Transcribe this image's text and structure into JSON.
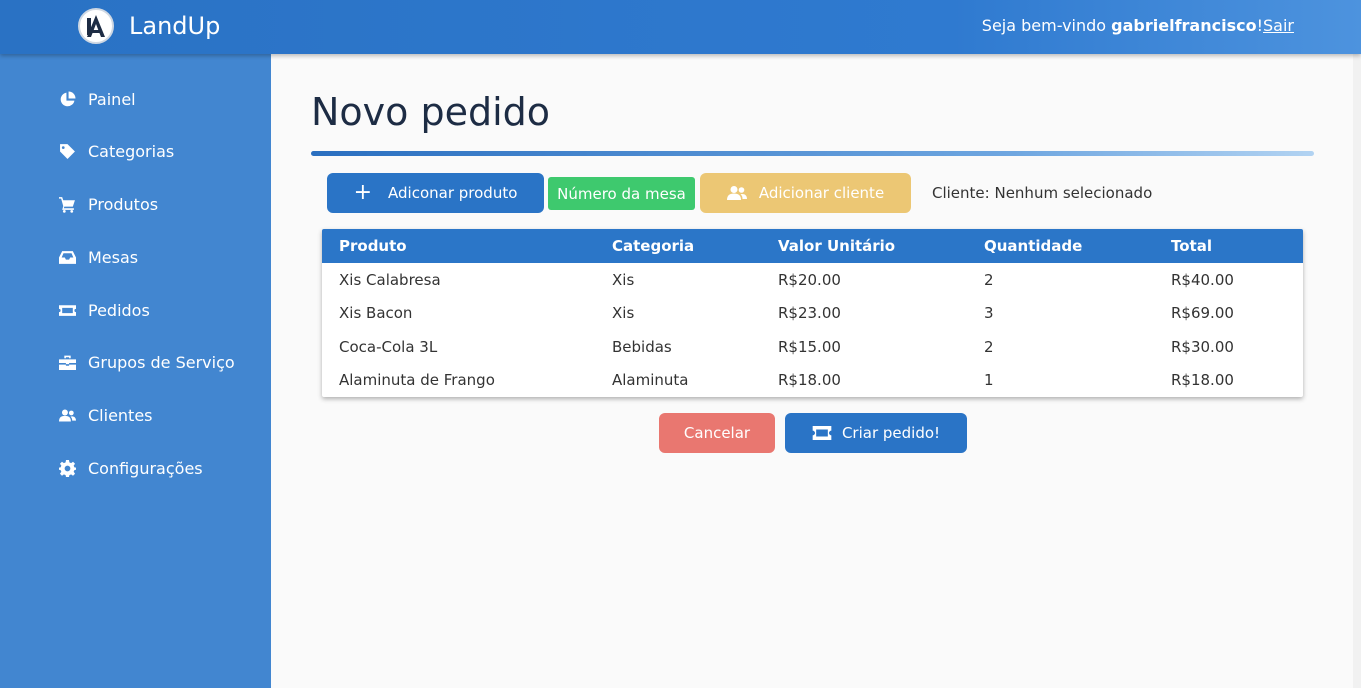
{
  "header": {
    "app_name": "LandUp",
    "welcome_prefix": "Seja bem-vindo",
    "username": "gabrielfrancisco",
    "welcome_suffix": "!",
    "logout": "Sair"
  },
  "sidebar": {
    "items": [
      {
        "label": "Painel",
        "icon": "pie-chart-icon"
      },
      {
        "label": "Categorias",
        "icon": "tag-icon"
      },
      {
        "label": "Produtos",
        "icon": "cart-icon"
      },
      {
        "label": "Mesas",
        "icon": "inbox-icon"
      },
      {
        "label": "Pedidos",
        "icon": "ticket-icon"
      },
      {
        "label": "Grupos de Serviço",
        "icon": "briefcase-icon"
      },
      {
        "label": "Clientes",
        "icon": "users-icon"
      },
      {
        "label": "Configurações",
        "icon": "gear-icon"
      }
    ]
  },
  "page": {
    "title": "Novo pedido"
  },
  "actions": {
    "add_product": "Adiconar produto",
    "table_number": "Número da mesa",
    "add_client": "Adicionar cliente",
    "client_status": "Cliente: Nenhum selecionado",
    "cancel": "Cancelar",
    "create_order": "Criar pedido!"
  },
  "table": {
    "headers": [
      "Produto",
      "Categoria",
      "Valor Unitário",
      "Quantidade",
      "Total"
    ],
    "rows": [
      [
        "Xis Calabresa",
        "Xis",
        "R$20.00",
        "2",
        "R$40.00"
      ],
      [
        "Xis Bacon",
        "Xis",
        "R$23.00",
        "3",
        "R$69.00"
      ],
      [
        "Coca-Cola 3L",
        "Bebidas",
        "R$15.00",
        "2",
        "R$30.00"
      ],
      [
        "Alaminuta de Frango",
        "Alaminuta",
        "R$18.00",
        "1",
        "R$18.00"
      ]
    ]
  },
  "colors": {
    "primary": "#2a74c6",
    "sidebar": "#4286d0",
    "success": "#3ec96e",
    "warning": "#ecc774",
    "danger": "#e97770"
  }
}
